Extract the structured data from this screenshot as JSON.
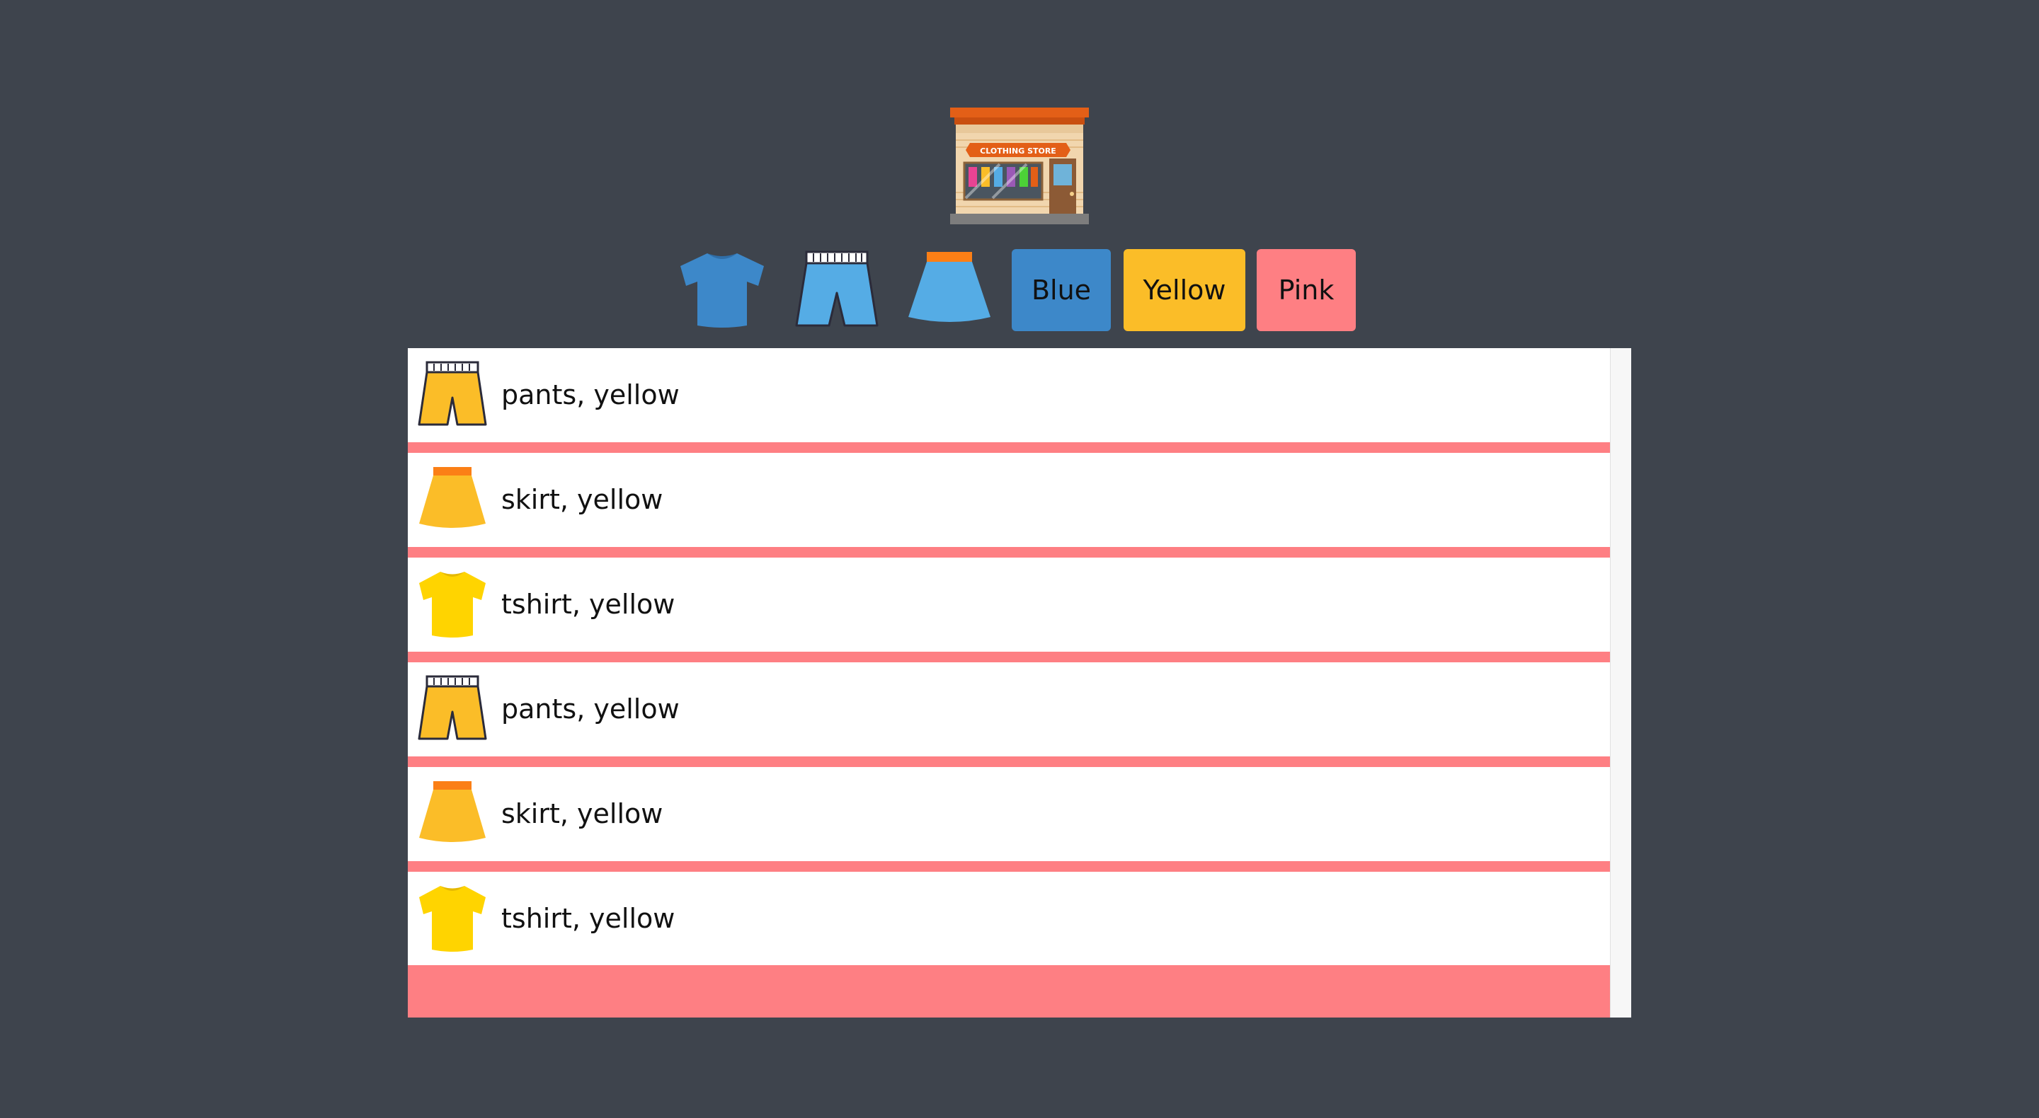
{
  "store": {
    "icon": "clothing-store-icon",
    "sign_text": "CLOTHING STORE"
  },
  "type_filters": [
    {
      "type": "tshirt",
      "icon": "tshirt-icon"
    },
    {
      "type": "pants",
      "icon": "pants-icon"
    },
    {
      "type": "skirt",
      "icon": "skirt-icon"
    }
  ],
  "color_filters": [
    {
      "label": "Blue",
      "color": "#3d88c9"
    },
    {
      "label": "Yellow",
      "color": "#fbbd28"
    },
    {
      "label": "Pink",
      "color": "#fe7f83"
    }
  ],
  "separator_color": "#fe7f83",
  "items": [
    {
      "type": "pants",
      "label": "pants, yellow",
      "icon": "pants-icon"
    },
    {
      "type": "skirt",
      "label": "skirt, yellow",
      "icon": "skirt-icon"
    },
    {
      "type": "tshirt",
      "label": "tshirt, yellow",
      "icon": "tshirt-icon"
    },
    {
      "type": "pants",
      "label": "pants, yellow",
      "icon": "pants-icon"
    },
    {
      "type": "skirt",
      "label": "skirt, yellow",
      "icon": "skirt-icon"
    },
    {
      "type": "tshirt",
      "label": "tshirt, yellow",
      "icon": "tshirt-icon"
    }
  ]
}
